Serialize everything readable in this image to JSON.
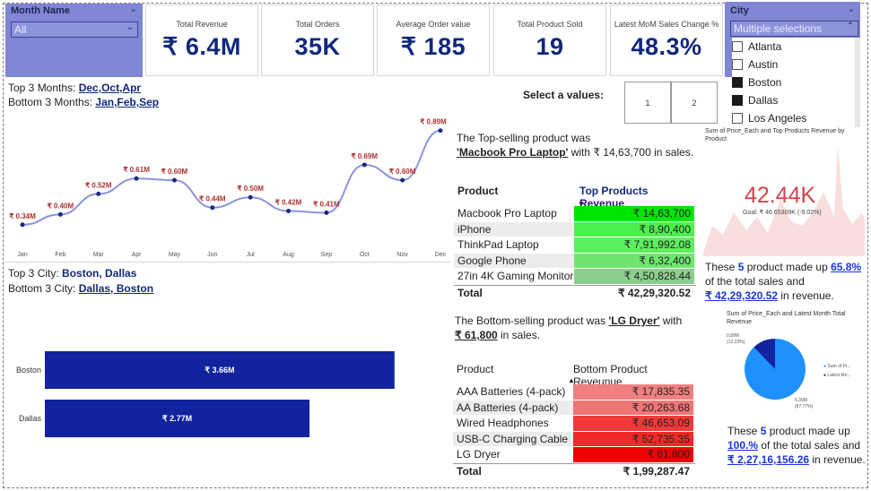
{
  "month_slicer": {
    "title": "Month Name",
    "value": "All"
  },
  "kpis": [
    {
      "label": "Total Revenue",
      "value": "₹ 6.4M"
    },
    {
      "label": "Total Orders",
      "value": "35K"
    },
    {
      "label": "Average Order value",
      "value": "₹ 185"
    },
    {
      "label": "Total Product Sold",
      "value": "19"
    },
    {
      "label": "Latest MoM Sales Change %",
      "value": "48.3%"
    }
  ],
  "city_slicer": {
    "title": "City",
    "value": "Multiple selections",
    "items": [
      {
        "label": "Atlanta",
        "checked": false
      },
      {
        "label": "Austin",
        "checked": false
      },
      {
        "label": "Boston",
        "checked": true
      },
      {
        "label": "Dallas",
        "checked": true
      },
      {
        "label": "Los Angeles",
        "checked": false
      }
    ]
  },
  "months_summary": {
    "top_prefix": "Top 3 Months: ",
    "top_value": "Dec,Oct,Apr",
    "bottom_prefix": "Bottom 3 Months: ",
    "bottom_value": "Jan,Feb,Sep"
  },
  "city_summary": {
    "top_prefix": "Top 3 City:  ",
    "top_value": "Boston, Dallas",
    "bottom_prefix": "Bottom 3 City: ",
    "bottom_value": "Dallas, Boston"
  },
  "select_values": {
    "label": "Select a values:",
    "options": [
      "1",
      "2"
    ]
  },
  "top_product": {
    "line1": "The Top-selling product  was",
    "name": "'Macbook Pro Laptop'",
    "with": " with ",
    "amount": "₹ 14,63,700",
    "suffix": " in sales."
  },
  "top_table": {
    "headers": [
      "Product",
      "Top Products Revenue"
    ],
    "rows": [
      {
        "product": "Macbook Pro Laptop",
        "revenue": "₹ 14,63,700",
        "color": "#00e600"
      },
      {
        "product": "iPhone",
        "revenue": "₹ 8,90,400",
        "color": "#4cf04c"
      },
      {
        "product": "ThinkPad Laptop",
        "revenue": "₹ 7,91,992.08",
        "color": "#5cf05c"
      },
      {
        "product": "Google Phone",
        "revenue": "₹ 6,32,400",
        "color": "#6ee66e"
      },
      {
        "product": "27in 4K Gaming Monitor",
        "revenue": "₹ 4,50,828.44",
        "color": "#8ad08a"
      }
    ],
    "total_label": "Total",
    "total_value": "₹ 42,29,320.52"
  },
  "top_share": {
    "pre": "These ",
    "count": "5",
    "mid": " product made up ",
    "pct": "65.8%",
    "line2": "of the total sales and",
    "amount": "₹ 42,29,320.52",
    "suffix": " in revenue."
  },
  "spark_card": {
    "title": "Sum of Price_Each and Top Products Revenue by Product",
    "value": "42.44K",
    "goal": "Goal: ₹ 46.65309K (-9.02%)"
  },
  "bottom_product": {
    "line1_pre": "The Bottom-selling product  was ",
    "name": "'LG Dryer'",
    "with": " with",
    "amount": "₹ 61,800",
    "suffix": " in sales."
  },
  "bottom_table": {
    "headers": [
      "Product",
      "Bottom Product Reveunue"
    ],
    "rows": [
      {
        "product": "AAA Batteries (4-pack)",
        "revenue": "₹ 17,835.35",
        "color": "#f08080"
      },
      {
        "product": "AA Batteries (4-pack)",
        "revenue": "₹ 20,263.68",
        "color": "#f07575"
      },
      {
        "product": "Wired Headphones",
        "revenue": "₹ 46,653.09",
        "color": "#f03a3a"
      },
      {
        "product": "USB-C Charging Cable",
        "revenue": "₹ 52,735.35",
        "color": "#f02a2a"
      },
      {
        "product": "LG Dryer",
        "revenue": "₹ 61,800",
        "color": "#f00000"
      }
    ],
    "total_label": "Total",
    "total_value": "₹ 1,99,287.47"
  },
  "pie_card": {
    "title": "Sum of Price_Each and Latest Month Total Revenue",
    "small_label": "0.89M",
    "small_pct": "(12.23%)",
    "big_label": "6.39M",
    "big_pct": "(87.77%)",
    "legend": [
      "Sum of Pr...",
      "Latest Mo..."
    ],
    "colors": [
      "#1e90ff",
      "#12239e"
    ]
  },
  "bottom_share": {
    "pre": "These ",
    "count": "5",
    "mid": " product made up",
    "pct": "100.%",
    "line2": "  of the total sales and",
    "amount": "₹ 2,27,16,156.26",
    "suffix": " in revenue."
  },
  "chart_data": [
    {
      "type": "line",
      "categories": [
        "Jan",
        "Feb",
        "Mar",
        "Apr",
        "May",
        "Jun",
        "Jul",
        "Aug",
        "Sep",
        "Oct",
        "Nov",
        "Dec"
      ],
      "values": [
        0.34,
        0.4,
        0.52,
        0.61,
        0.6,
        0.44,
        0.5,
        0.42,
        0.41,
        0.69,
        0.6,
        0.89
      ],
      "labels": [
        "₹ 0.34M",
        "₹ 0.40M",
        "₹ 0.52M",
        "₹ 0.61M",
        "₹ 0.60M",
        "₹ 0.44M",
        "₹ 0.50M",
        "₹ 0.42M",
        "₹ 0.41M",
        "₹ 0.69M",
        "₹ 0.60M",
        "₹ 0.89M"
      ],
      "ylim": [
        0.25,
        0.92
      ],
      "line_color": "#8b93e0",
      "label_color": "#b03030"
    },
    {
      "type": "bar",
      "orientation": "horizontal",
      "categories": [
        "Boston",
        "Dallas"
      ],
      "values": [
        3.66,
        2.77
      ],
      "labels": [
        "₹ 3.66M",
        "₹ 2.77M"
      ],
      "xlim": [
        0,
        4.0
      ],
      "color": "#12239e"
    },
    {
      "type": "pie",
      "categories": [
        "Sum of Price_Each",
        "Latest Month Total Revenue"
      ],
      "values": [
        0.89,
        6.39
      ]
    }
  ]
}
